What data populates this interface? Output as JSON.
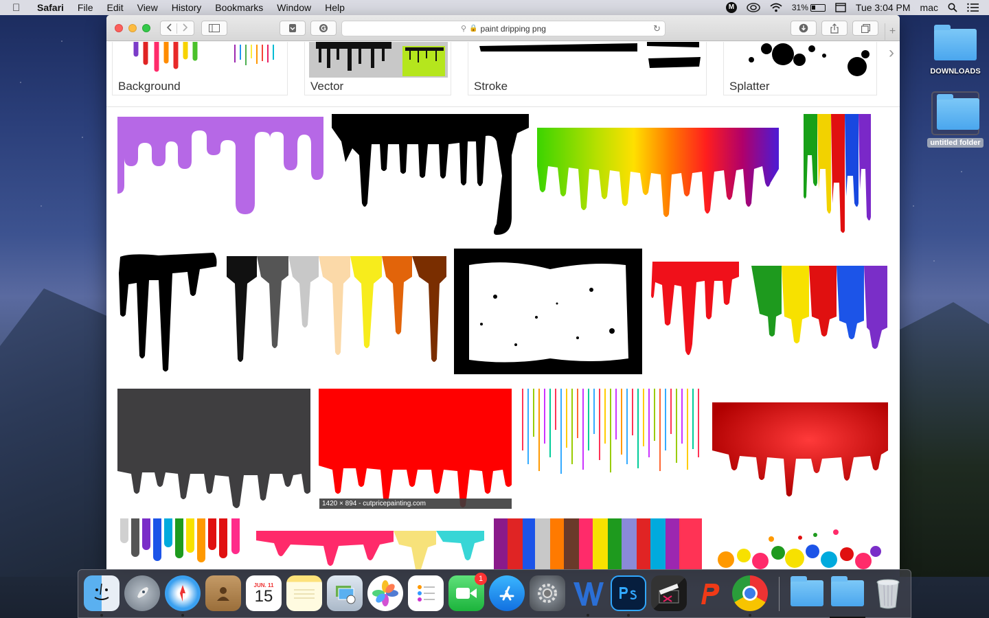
{
  "menubar": {
    "app_name": "Safari",
    "menus": [
      "File",
      "Edit",
      "View",
      "History",
      "Bookmarks",
      "Window",
      "Help"
    ],
    "status_badge": "M",
    "battery": "31%",
    "clock": "Tue 3:04 PM",
    "user": "mac"
  },
  "browser": {
    "url": "paint dripping png",
    "related_searches": [
      "Background",
      "Vector",
      "Stroke",
      "Splatter"
    ],
    "hover_caption": "1420 × 894 - cutpricepainting.com",
    "colors": {
      "purple": "#b668e6",
      "red": "#ff0000",
      "dark_red": "#c40000",
      "grey": "#3f3e40",
      "black": "#000000"
    }
  },
  "desktop": {
    "icons": [
      {
        "label": "DOWNLOADS"
      },
      {
        "label": "untitled folder"
      }
    ]
  },
  "dock": {
    "calendar_month": "JUN. 11",
    "calendar_day": "15",
    "facetime_badge": "1",
    "items": [
      "finder-icon",
      "launchpad-icon",
      "safari-icon",
      "contacts-icon",
      "calendar-icon",
      "notes-icon",
      "preview-icon",
      "photos-icon",
      "reminders-icon",
      "facetime-icon",
      "app-store-icon",
      "system-preferences-icon",
      "word-icon",
      "photoshop-icon",
      "final-cut-icon",
      "polaris-icon",
      "chrome-icon",
      "folder-icon",
      "downloads-folder-icon",
      "trash-icon"
    ]
  }
}
